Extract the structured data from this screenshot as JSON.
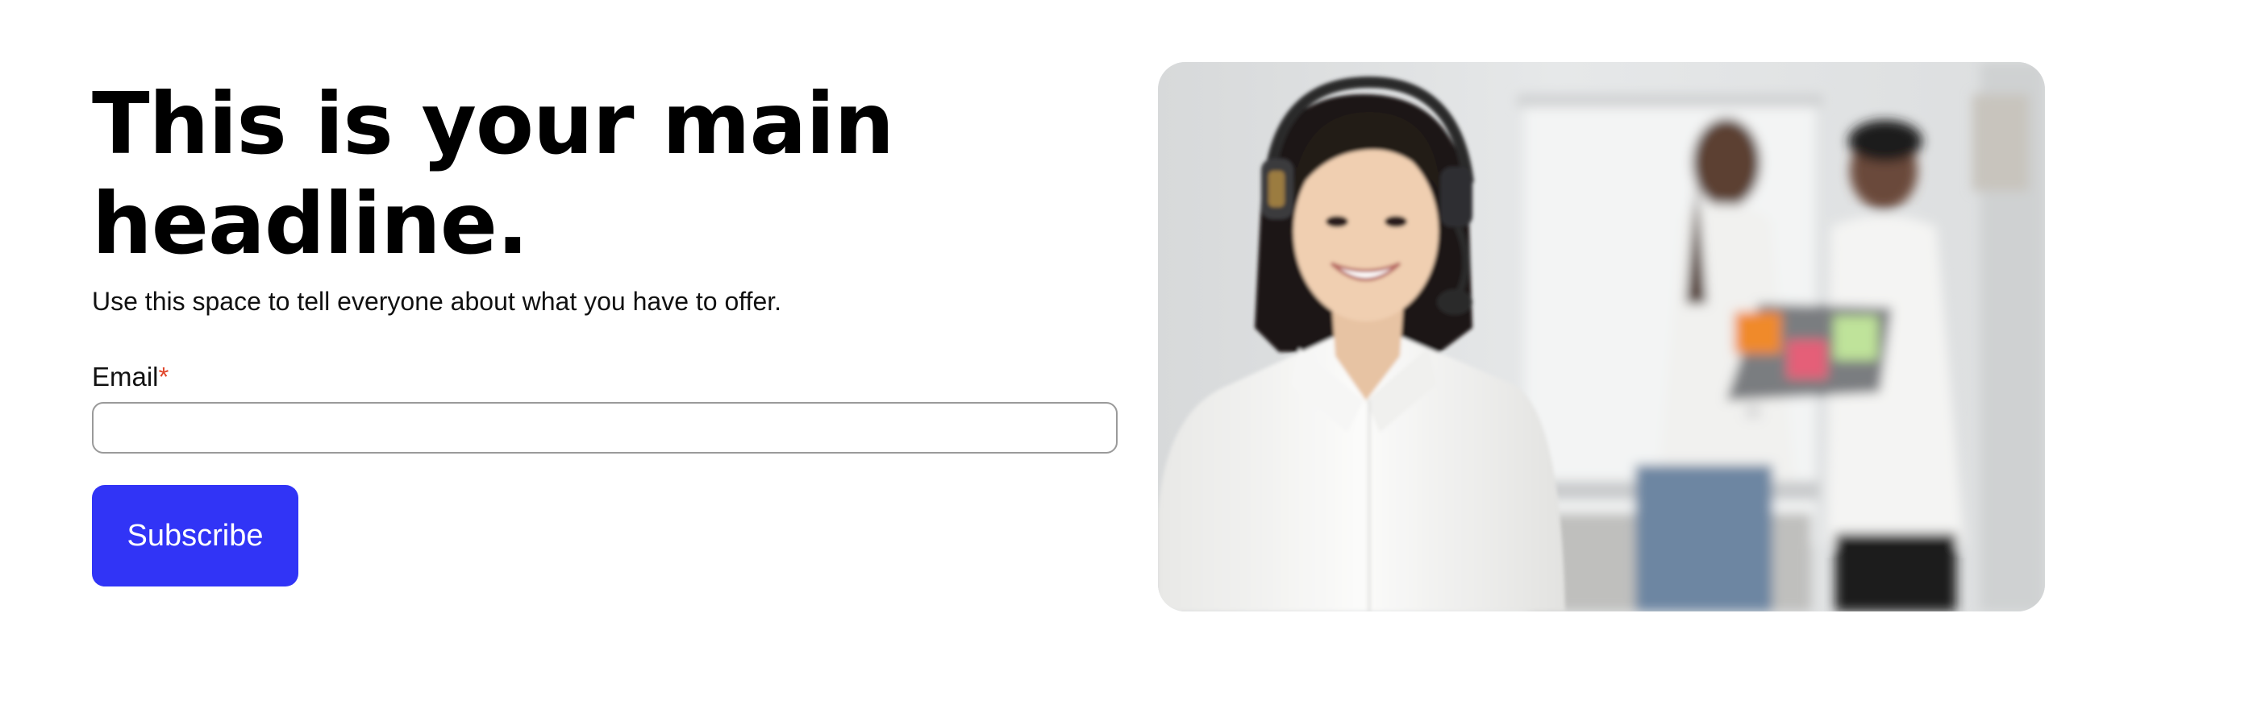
{
  "hero": {
    "headline": "This is your main headline.",
    "subtext": "Use this space to tell everyone about what you have to offer."
  },
  "form": {
    "email_label": "Email",
    "required_marker": "*",
    "email_value": "",
    "subscribe_label": "Subscribe"
  },
  "image": {
    "description": "photo-of-customer-support-agent-with-headset"
  },
  "colors": {
    "button_background": "#3134f6",
    "button_text": "#ffffff",
    "required_marker": "#e0462c",
    "input_border": "#9a9a9a"
  }
}
